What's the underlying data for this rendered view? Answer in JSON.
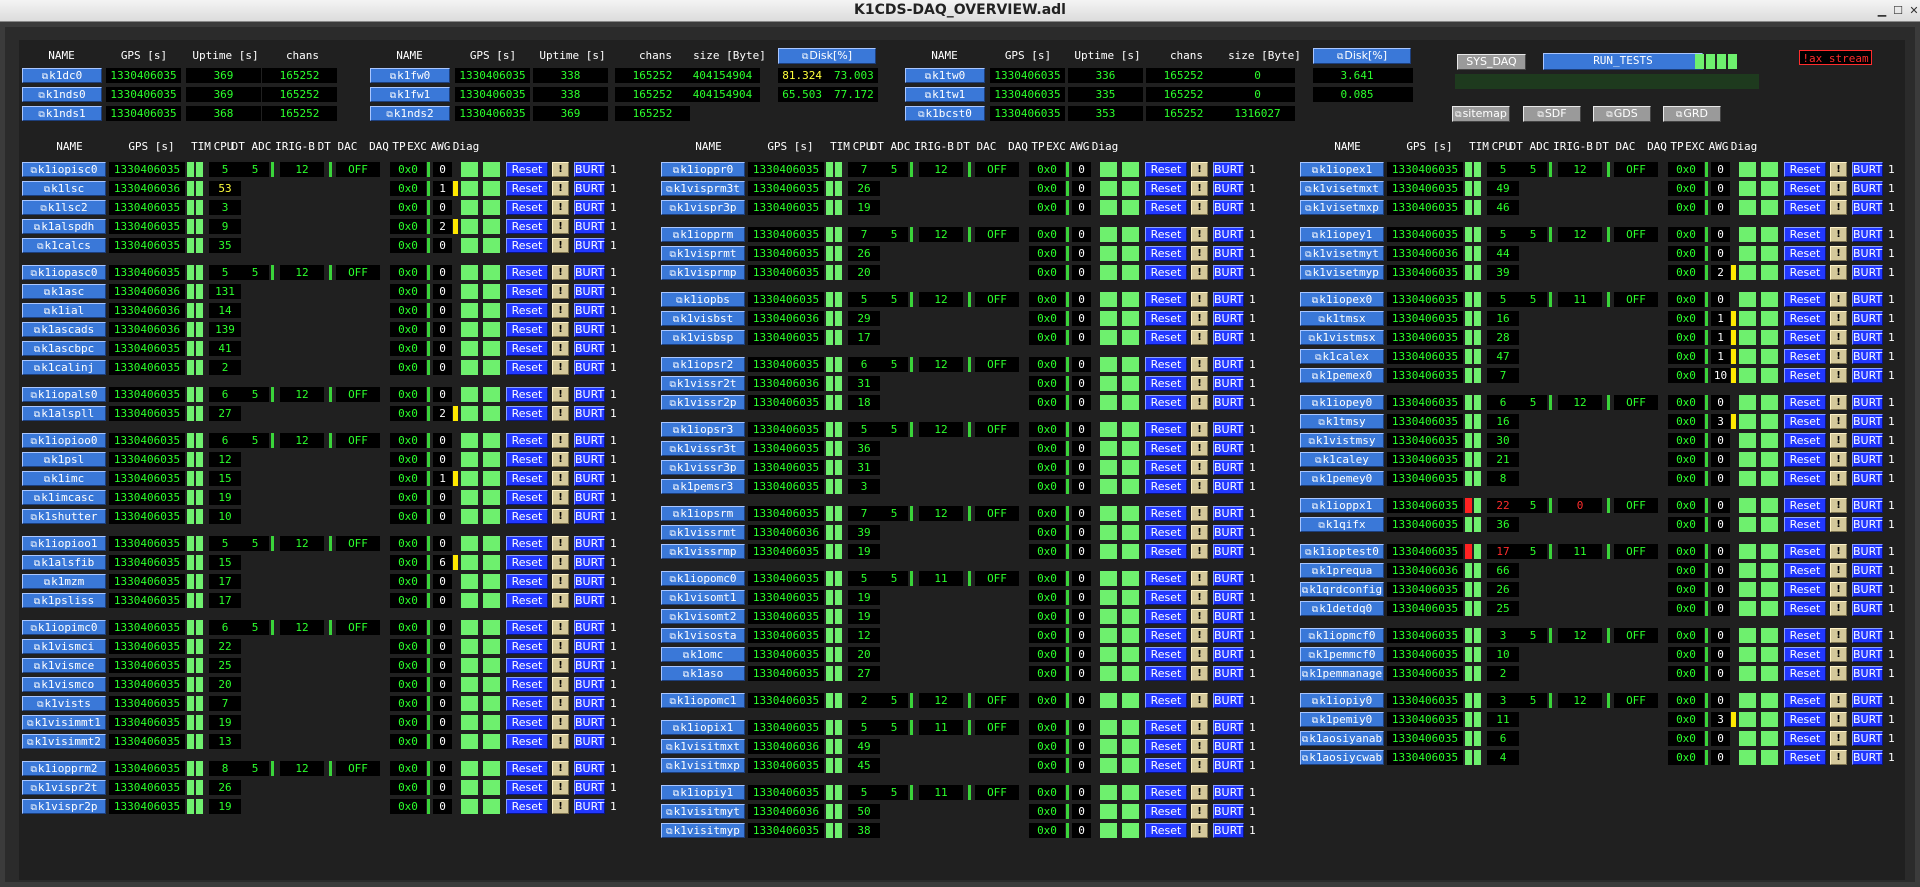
{
  "window_title": "K1CDS-DAQ_OVERVIEW.adl",
  "top": {
    "headers": [
      "NAME",
      "GPS [s]",
      "Uptime [s]",
      "chans",
      "size [Byte]",
      "Disk[%]"
    ],
    "disk_label": "Disk[%]",
    "groups": [
      {
        "rows": [
          [
            "k1dc0",
            "1330406035",
            "369",
            "165252"
          ],
          [
            "k1nds0",
            "1330406035",
            "369",
            "165252"
          ],
          [
            "k1nds1",
            "1330406035",
            "368",
            "165252"
          ]
        ]
      },
      {
        "rows": [
          [
            "k1fw0",
            "1330406035",
            "338",
            "165252",
            "404154904",
            "81.324",
            "73.003"
          ],
          [
            "k1fw1",
            "1330406035",
            "338",
            "165252",
            "404154904",
            "65.503",
            "77.172"
          ],
          [
            "k1nds2",
            "1330406035",
            "369",
            "165252"
          ]
        ]
      },
      {
        "rows": [
          [
            "k1tw0",
            "1330406035",
            "336",
            "165252",
            "0",
            "3.641"
          ],
          [
            "k1tw1",
            "1330406035",
            "335",
            "165252",
            "0",
            "0.085"
          ],
          [
            "k1bcst0",
            "1330406035",
            "353",
            "165252",
            "1316027"
          ]
        ]
      }
    ],
    "sys_daq": "SYS_DAQ",
    "run_tests": "RUN_TESTS",
    "ax_stream": "!ax_stream",
    "nav": [
      "sitemap",
      "SDF",
      "GDS",
      "GRD"
    ]
  },
  "tbl_headers": [
    "NAME",
    "GPS [s]",
    "TIM",
    "CPU",
    "DT ADC",
    "IRIG-B",
    "DT DAC",
    "DAQ",
    "TP",
    "EXC",
    "AWG",
    "Diag"
  ],
  "reset_label": "Reset",
  "burt_label": "BURT",
  "excl_label": "!",
  "columns": [
    {
      "groups": [
        {
          "iop": [
            "5",
            "12",
            "OFF"
          ],
          "rows": [
            [
              "k1iopisc0",
              "1330406035",
              "5",
              "0x0",
              "0"
            ],
            [
              "k1lsc",
              "1330406036",
              "53",
              "0x0",
              "1"
            ],
            [
              "k1lsc2",
              "1330406035",
              "3",
              "0x0",
              "0"
            ],
            [
              "k1alspdh",
              "1330406035",
              "9",
              "0x0",
              "2"
            ],
            [
              "k1calcs",
              "1330406035",
              "35",
              "0x0",
              "0"
            ]
          ]
        },
        {
          "iop": [
            "5",
            "12",
            "OFF"
          ],
          "rows": [
            [
              "k1iopasc0",
              "1330406035",
              "5",
              "0x0",
              "0"
            ],
            [
              "k1asc",
              "1330406036",
              "131",
              "0x0",
              "0"
            ],
            [
              "k1ial",
              "1330406036",
              "14",
              "0x0",
              "0"
            ],
            [
              "k1ascads",
              "1330406036",
              "139",
              "0x0",
              "0"
            ],
            [
              "k1ascbpc",
              "1330406035",
              "41",
              "0x0",
              "0"
            ],
            [
              "k1calinj",
              "1330406035",
              "2",
              "0x0",
              "0"
            ]
          ]
        },
        {
          "iop": [
            "5",
            "12",
            "OFF"
          ],
          "rows": [
            [
              "k1iopals0",
              "1330406035",
              "6",
              "0x0",
              "0"
            ],
            [
              "k1alspll",
              "1330406035",
              "27",
              "0x0",
              "2"
            ]
          ]
        },
        {
          "iop": [
            "5",
            "12",
            "OFF"
          ],
          "rows": [
            [
              "k1iopioo0",
              "1330406035",
              "6",
              "0x0",
              "0"
            ],
            [
              "k1psl",
              "1330406035",
              "12",
              "0x0",
              "0"
            ],
            [
              "k1imc",
              "1330406035",
              "15",
              "0x0",
              "1"
            ],
            [
              "k1imcasc",
              "1330406035",
              "19",
              "0x0",
              "0"
            ],
            [
              "k1shutter",
              "1330406035",
              "10",
              "0x0",
              "0"
            ]
          ]
        },
        {
          "iop": [
            "5",
            "12",
            "OFF"
          ],
          "rows": [
            [
              "k1iopioo1",
              "1330406035",
              "5",
              "0x0",
              "0"
            ],
            [
              "k1alsfib",
              "1330406035",
              "15",
              "0x0",
              "6"
            ],
            [
              "k1mzm",
              "1330406035",
              "17",
              "0x0",
              "0"
            ],
            [
              "k1psliss",
              "1330406035",
              "17",
              "0x0",
              "0"
            ]
          ]
        },
        {
          "iop": [
            "5",
            "12",
            "OFF"
          ],
          "rows": [
            [
              "k1iopimc0",
              "1330406035",
              "6",
              "0x0",
              "0"
            ],
            [
              "k1vismci",
              "1330406035",
              "22",
              "0x0",
              "0"
            ],
            [
              "k1vismce",
              "1330406035",
              "25",
              "0x0",
              "0"
            ],
            [
              "k1vismco",
              "1330406035",
              "20",
              "0x0",
              "0"
            ],
            [
              "k1vists",
              "1330406035",
              "7",
              "0x0",
              "0"
            ],
            [
              "k1visimmt1",
              "1330406035",
              "19",
              "0x0",
              "0"
            ],
            [
              "k1visimmt2",
              "1330406035",
              "13",
              "0x0",
              "0"
            ]
          ]
        },
        {
          "iop": [
            "5",
            "12",
            "OFF"
          ],
          "rows": [
            [
              "k1iopprm2",
              "1330406035",
              "8",
              "0x0",
              "0"
            ],
            [
              "k1vispr2t",
              "1330406035",
              "26",
              "0x0",
              "0"
            ],
            [
              "k1vispr2p",
              "1330406035",
              "19",
              "0x0",
              "0"
            ]
          ]
        }
      ]
    },
    {
      "groups": [
        {
          "iop": [
            "5",
            "12",
            "OFF"
          ],
          "rows": [
            [
              "k1ioppr0",
              "1330406035",
              "7",
              "0x0",
              "0"
            ],
            [
              "k1visprm3t",
              "1330406035",
              "26",
              "0x0",
              "0"
            ],
            [
              "k1vispr3p",
              "1330406035",
              "19",
              "0x0",
              "0"
            ]
          ]
        },
        {
          "iop": [
            "5",
            "12",
            "OFF"
          ],
          "rows": [
            [
              "k1iopprm",
              "1330406035",
              "7",
              "0x0",
              "0"
            ],
            [
              "k1visprmt",
              "1330406035",
              "26",
              "0x0",
              "0"
            ],
            [
              "k1visprmp",
              "1330406035",
              "20",
              "0x0",
              "0"
            ]
          ]
        },
        {
          "iop": [
            "5",
            "12",
            "OFF"
          ],
          "rows": [
            [
              "k1iopbs",
              "1330406035",
              "5",
              "0x0",
              "0"
            ],
            [
              "k1visbst",
              "1330406036",
              "29",
              "0x0",
              "0"
            ],
            [
              "k1visbsp",
              "1330406035",
              "17",
              "0x0",
              "0"
            ]
          ]
        },
        {
          "iop": [
            "5",
            "12",
            "OFF"
          ],
          "rows": [
            [
              "k1iopsr2",
              "1330406035",
              "6",
              "0x0",
              "0"
            ],
            [
              "k1vissr2t",
              "1330406036",
              "31",
              "0x0",
              "0"
            ],
            [
              "k1vissr2p",
              "1330406035",
              "18",
              "0x0",
              "0"
            ]
          ]
        },
        {
          "iop": [
            "5",
            "12",
            "OFF"
          ],
          "rows": [
            [
              "k1iopsr3",
              "1330406035",
              "5",
              "0x0",
              "0"
            ],
            [
              "k1vissr3t",
              "1330406035",
              "36",
              "0x0",
              "0"
            ],
            [
              "k1vissr3p",
              "1330406035",
              "31",
              "0x0",
              "0"
            ],
            [
              "k1pemsr3",
              "1330406035",
              "3",
              "0x0",
              "0"
            ]
          ]
        },
        {
          "iop": [
            "5",
            "12",
            "OFF"
          ],
          "rows": [
            [
              "k1iopsrm",
              "1330406035",
              "7",
              "0x0",
              "0"
            ],
            [
              "k1vissrmt",
              "1330406036",
              "39",
              "0x0",
              "0"
            ],
            [
              "k1vissrmp",
              "1330406035",
              "19",
              "0x0",
              "0"
            ]
          ]
        },
        {
          "iop": [
            "5",
            "11",
            "OFF"
          ],
          "rows": [
            [
              "k1iopomc0",
              "1330406035",
              "5",
              "0x0",
              "0"
            ],
            [
              "k1visomt1",
              "1330406035",
              "19",
              "0x0",
              "0"
            ],
            [
              "k1visomt2",
              "1330406035",
              "19",
              "0x0",
              "0"
            ],
            [
              "k1visosta",
              "1330406035",
              "12",
              "0x0",
              "0"
            ],
            [
              "k1omc",
              "1330406035",
              "20",
              "0x0",
              "0"
            ],
            [
              "k1aso",
              "1330406035",
              "27",
              "0x0",
              "0"
            ]
          ]
        },
        {
          "iop": [
            "5",
            "12",
            "OFF"
          ],
          "rows": [
            [
              "k1iopomc1",
              "1330406035",
              "2",
              "0x0",
              "0"
            ]
          ]
        },
        {
          "iop": [
            "5",
            "11",
            "OFF"
          ],
          "rows": [
            [
              "k1iopix1",
              "1330406035",
              "5",
              "0x0",
              "0"
            ],
            [
              "k1visitmxt",
              "1330406036",
              "49",
              "0x0",
              "0"
            ],
            [
              "k1visitmxp",
              "1330406035",
              "45",
              "0x0",
              "0"
            ]
          ]
        },
        {
          "iop": [
            "5",
            "11",
            "OFF"
          ],
          "rows": [
            [
              "k1iopiy1",
              "1330406035",
              "5",
              "0x0",
              "0"
            ],
            [
              "k1visitmyt",
              "1330406036",
              "50",
              "0x0",
              "0"
            ],
            [
              "k1visitmyp",
              "1330406035",
              "38",
              "0x0",
              "0"
            ]
          ]
        }
      ]
    },
    {
      "groups": [
        {
          "iop": [
            "5",
            "12",
            "OFF"
          ],
          "rows": [
            [
              "k1iopex1",
              "1330406035",
              "5",
              "0x0",
              "0"
            ],
            [
              "k1visetmxt",
              "1330406035",
              "49",
              "0x0",
              "0"
            ],
            [
              "k1visetmxp",
              "1330406035",
              "46",
              "0x0",
              "0"
            ]
          ]
        },
        {
          "iop": [
            "5",
            "12",
            "OFF"
          ],
          "rows": [
            [
              "k1iopey1",
              "1330406035",
              "5",
              "0x0",
              "0"
            ],
            [
              "k1visetmyt",
              "1330406036",
              "44",
              "0x0",
              "0"
            ],
            [
              "k1visetmyp",
              "1330406035",
              "39",
              "0x0",
              "2"
            ]
          ]
        },
        {
          "iop": [
            "5",
            "11",
            "OFF"
          ],
          "rows": [
            [
              "k1iopex0",
              "1330406035",
              "5",
              "0x0",
              "0"
            ],
            [
              "k1tmsx",
              "1330406035",
              "16",
              "0x0",
              "1"
            ],
            [
              "k1vistmsx",
              "1330406035",
              "28",
              "0x0",
              "1"
            ],
            [
              "k1calex",
              "1330406035",
              "47",
              "0x0",
              "1"
            ],
            [
              "k1pemex0",
              "1330406035",
              "7",
              "0x0",
              "10"
            ]
          ]
        },
        {
          "iop": [
            "5",
            "12",
            "OFF"
          ],
          "rows": [
            [
              "k1iopey0",
              "1330406035",
              "6",
              "0x0",
              "0"
            ],
            [
              "k1tmsy",
              "1330406035",
              "16",
              "0x0",
              "3"
            ],
            [
              "k1vistmsy",
              "1330406035",
              "30",
              "0x0",
              "0"
            ],
            [
              "k1caley",
              "1330406035",
              "21",
              "0x0",
              "0"
            ],
            [
              "k1pemey0",
              "1330406035",
              "8",
              "0x0",
              "0"
            ]
          ]
        },
        {
          "iop": [
            "5",
            "0",
            "OFF"
          ],
          "bad": true,
          "rows": [
            [
              "k1ioppx1",
              "1330406035",
              "22",
              "0x0",
              "0"
            ],
            [
              "k1qifx",
              "1330406035",
              "36",
              "0x0",
              "0"
            ]
          ]
        },
        {
          "iop": [
            "5",
            "11",
            "OFF"
          ],
          "bad": true,
          "rows": [
            [
              "k1ioptest0",
              "1330406035",
              "17",
              "0x0",
              "0"
            ],
            [
              "k1prequa",
              "1330406036",
              "66",
              "0x0",
              "0"
            ],
            [
              "k1qrdconfig",
              "1330406035",
              "26",
              "0x0",
              "0"
            ],
            [
              "k1detdq0",
              "1330406035",
              "25",
              "0x0",
              "0"
            ]
          ]
        },
        {
          "iop": [
            "5",
            "12",
            "OFF"
          ],
          "rows": [
            [
              "k1iopmcf0",
              "1330406035",
              "3",
              "0x0",
              "0"
            ],
            [
              "k1pemmcf0",
              "1330406035",
              "10",
              "0x0",
              "0"
            ],
            [
              "k1pemmanage",
              "1330406035",
              "2",
              "0x0",
              "0"
            ]
          ]
        },
        {
          "iop": [
            "5",
            "12",
            "OFF"
          ],
          "rows": [
            [
              "k1iopiy0",
              "1330406035",
              "3",
              "0x0",
              "0"
            ],
            [
              "k1pemiy0",
              "1330406035",
              "11",
              "0x0",
              "3"
            ],
            [
              "k1aosiyanab",
              "1330406035",
              "6",
              "0x0",
              "0"
            ],
            [
              "k1aosiycwab",
              "1330406035",
              "4",
              "0x0",
              "0"
            ]
          ]
        }
      ]
    }
  ]
}
